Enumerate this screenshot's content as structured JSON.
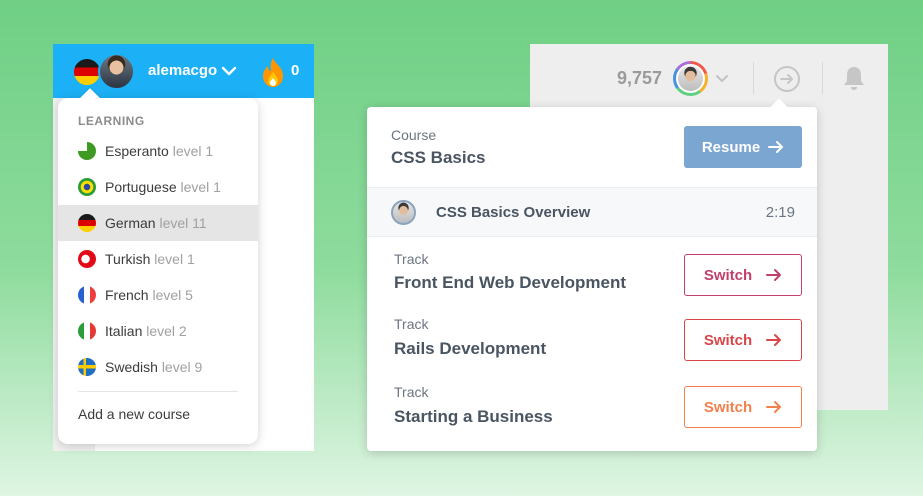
{
  "left": {
    "username": "alemacgo",
    "streak": "0",
    "menu_title": "LEARNING",
    "languages": [
      {
        "name": "Esperanto",
        "level": "level 1",
        "flag": "esperanto-flag"
      },
      {
        "name": "Portuguese",
        "level": "level 1",
        "flag": "brazil-flag"
      },
      {
        "name": "German",
        "level": "level 11",
        "flag": "germany-flag",
        "active": true
      },
      {
        "name": "Turkish",
        "level": "level 1",
        "flag": "turkey-flag"
      },
      {
        "name": "French",
        "level": "level 5",
        "flag": "france-flag"
      },
      {
        "name": "Italian",
        "level": "level 2",
        "flag": "italy-flag"
      },
      {
        "name": "Swedish",
        "level": "level 9",
        "flag": "sweden-flag"
      }
    ],
    "add_course": "Add a new course",
    "colors": {
      "topbar": "#1cb0f6",
      "flame": "#ff9600"
    }
  },
  "right": {
    "points": "9,757",
    "course": {
      "label": "Course",
      "title": "CSS Basics",
      "resume": "Resume"
    },
    "overview": {
      "title": "CSS Basics Overview",
      "duration": "2:19"
    },
    "tracks": [
      {
        "label": "Track",
        "title": "Front End Web Development",
        "action": "Switch",
        "color": "#c0406a"
      },
      {
        "label": "Track",
        "title": "Rails Development",
        "action": "Switch",
        "color": "#d9464a"
      },
      {
        "label": "Track",
        "title": "Starting a Business",
        "action": "Switch",
        "color": "#f0804c"
      }
    ],
    "colors": {
      "resume": "#7ba6d1",
      "text": "#4a5562"
    }
  }
}
